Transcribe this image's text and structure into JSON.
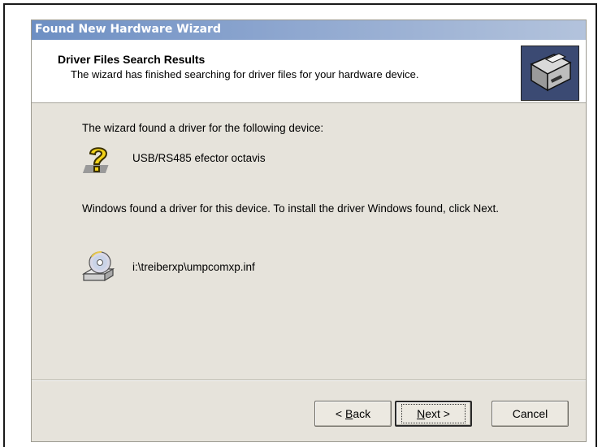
{
  "window": {
    "title": "Found New Hardware Wizard"
  },
  "header": {
    "title": "Driver Files Search Results",
    "subtitle": "The wizard has finished searching for driver files for your hardware device.",
    "icon": "hardware-wizard-icon"
  },
  "body": {
    "found_text": "The wizard found a driver for the following device:",
    "device_name": "USB/RS485 efector octavis",
    "device_icon": "unknown-device-question-icon",
    "instruction_text": "Windows found a driver for this device. To install the driver Windows found, click Next.",
    "driver_path": "i:\\treiberxp\\umpcomxp.inf",
    "driver_icon": "cd-drive-icon"
  },
  "buttons": {
    "back_prefix": "< ",
    "back_accel": "B",
    "back_rest": "ack",
    "next_accel": "N",
    "next_rest": "ext >",
    "cancel": "Cancel"
  },
  "colors": {
    "title_gradient_start": "#6d8fc3",
    "dialog_face": "#e6e3db",
    "header_bg": "#ffffff"
  }
}
